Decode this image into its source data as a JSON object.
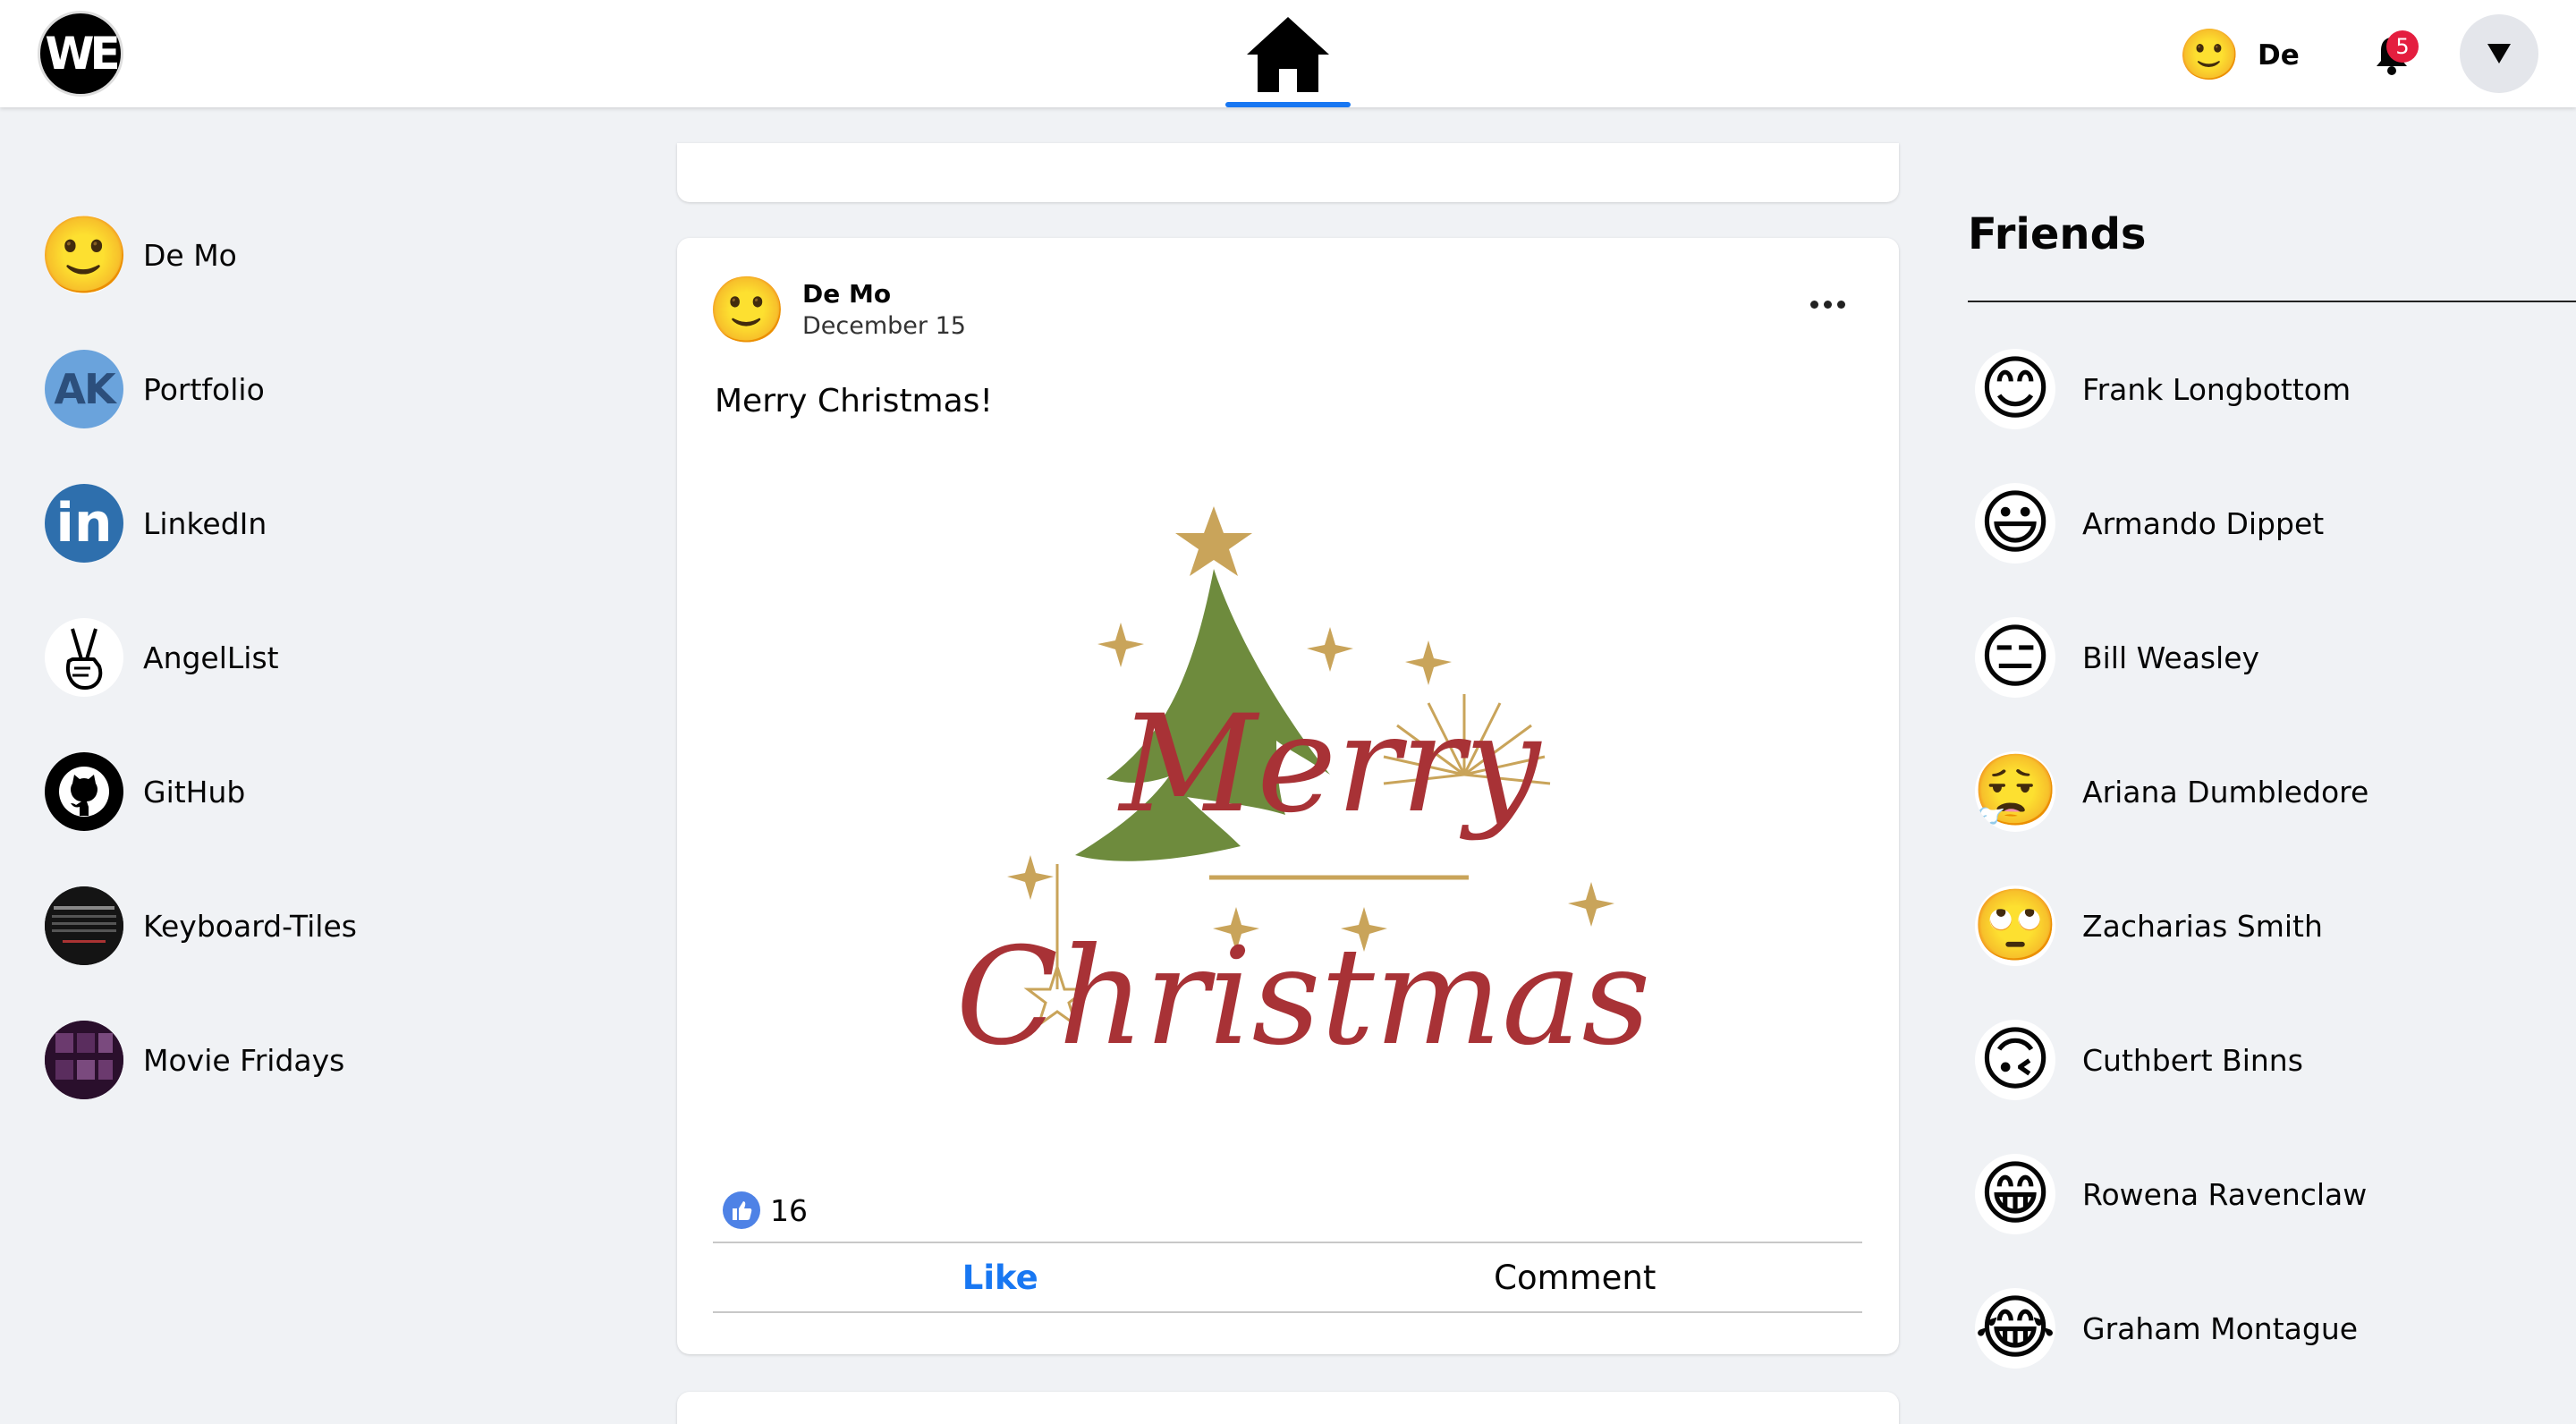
{
  "topbar": {
    "logo_text": "WE",
    "user_name": "De",
    "user_emoji": "🙂",
    "notification_count": "5"
  },
  "sidebar": {
    "items": [
      {
        "label": "De Mo",
        "icon": "smile-emoji-icon"
      },
      {
        "label": "Portfolio",
        "icon": "ak-logo-icon",
        "icon_text": "AK"
      },
      {
        "label": "LinkedIn",
        "icon": "linkedin-icon",
        "icon_text": "in"
      },
      {
        "label": "AngelList",
        "icon": "angellist-icon"
      },
      {
        "label": "GitHub",
        "icon": "github-icon"
      },
      {
        "label": "Keyboard-Tiles",
        "icon": "keyboard-tiles-thumbnail"
      },
      {
        "label": "Movie Fridays",
        "icon": "movie-fridays-thumbnail"
      }
    ]
  },
  "post": {
    "author": "De Mo",
    "author_emoji": "🙂",
    "date": "December 15",
    "text": "Merry Christmas!",
    "image_text_line1": "Merry",
    "image_text_line2": "Christmas",
    "like_count": "16",
    "like_label": "Like",
    "comment_label": "Comment"
  },
  "friends": {
    "title": "Friends",
    "list": [
      {
        "name": "Frank Longbottom",
        "emoji": "😊"
      },
      {
        "name": "Armando Dippet",
        "emoji": "😃"
      },
      {
        "name": "Bill Weasley",
        "emoji": "😑"
      },
      {
        "name": "Ariana Dumbledore",
        "emoji": "😮‍💨"
      },
      {
        "name": "Zacharias Smith",
        "emoji": "🙄"
      },
      {
        "name": "Cuthbert Binns",
        "emoji": "🙃"
      },
      {
        "name": "Rowena Ravenclaw",
        "emoji": "😁"
      },
      {
        "name": "Graham Montague",
        "emoji": "😂"
      }
    ]
  },
  "colors": {
    "accent": "#1877f2",
    "badge": "#e41e3f",
    "tree_green": "#6e8b3d",
    "text_red": "#a83236",
    "star_gold": "#c9a45a"
  }
}
